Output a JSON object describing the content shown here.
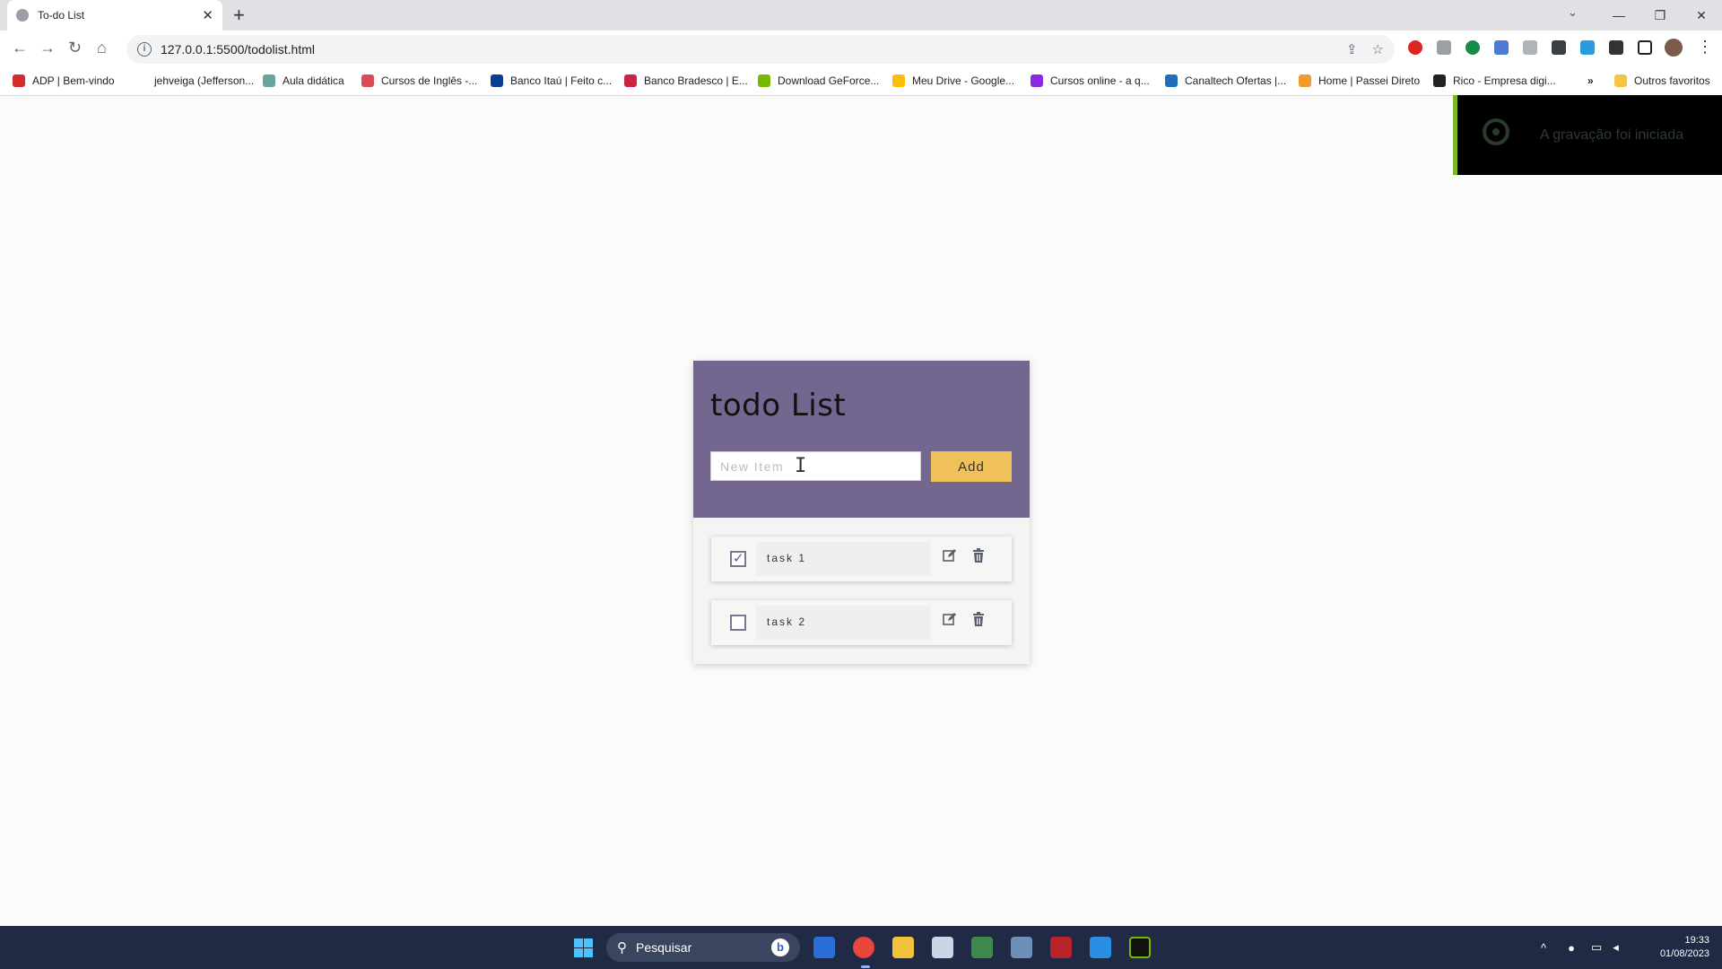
{
  "browser": {
    "tab_title": "To-do List",
    "tab_close": "✕",
    "new_tab": "+",
    "url": "127.0.0.1:5500/todolist.html",
    "window_controls": [
      "—",
      "❐",
      "✕"
    ],
    "bookmarks": [
      {
        "label": "ADP | Bem-vindo",
        "color": "#d42b2b"
      },
      {
        "label": "jehveiga (Jefferson...",
        "color": "#ffffff"
      },
      {
        "label": "Aula didática",
        "color": "#6aa5a0"
      },
      {
        "label": "Cursos de Inglês -...",
        "color": "#d94b5a"
      },
      {
        "label": "Banco Itaú | Feito c...",
        "color": "#0b3d91"
      },
      {
        "label": "Banco Bradesco | E...",
        "color": "#cc2244"
      },
      {
        "label": "Download GeForce...",
        "color": "#76b900"
      },
      {
        "label": "Meu Drive - Google...",
        "color": "#fbbc04"
      },
      {
        "label": "Cursos online - a q...",
        "color": "#8a2be2"
      },
      {
        "label": "Canaltech Ofertas |...",
        "color": "#1e6fb8"
      },
      {
        "label": "Home | Passei Direto",
        "color": "#f29a2e"
      },
      {
        "label": "Rico - Empresa digi...",
        "color": "#222222"
      }
    ],
    "bookmarks_more": "»",
    "other_bookmarks": "Outros favoritos"
  },
  "toast": {
    "text": "A gravação foi iniciada"
  },
  "todo": {
    "title": "todo List",
    "input_placeholder": "New Item",
    "add_label": "Add",
    "tasks": [
      {
        "label": "task 1",
        "checked": true
      },
      {
        "label": "task 2",
        "checked": false
      }
    ]
  },
  "taskbar": {
    "search_label": "Pesquisar",
    "time": "19:33",
    "date": "01/08/2023"
  }
}
